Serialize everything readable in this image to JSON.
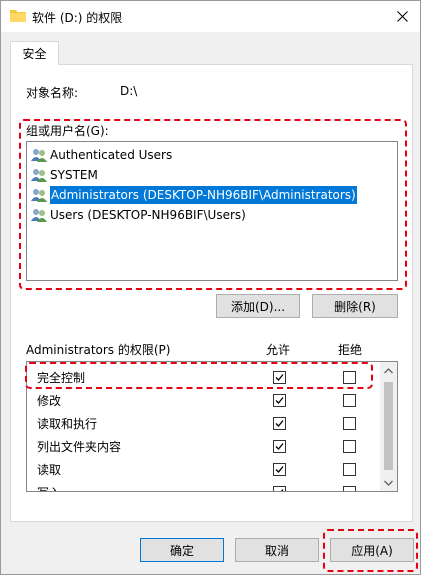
{
  "window": {
    "title": "软件 (D:) 的权限"
  },
  "tabs": [
    {
      "label": "安全"
    }
  ],
  "object": {
    "label": "对象名称:",
    "value": "D:\\"
  },
  "groups": {
    "label": "组或用户名(G):",
    "items": [
      {
        "name": "Authenticated Users",
        "selected": false
      },
      {
        "name": "SYSTEM",
        "selected": false
      },
      {
        "name": "Administrators (DESKTOP-NH96BIF\\Administrators)",
        "selected": true
      },
      {
        "name": "Users (DESKTOP-NH96BIF\\Users)",
        "selected": false
      }
    ],
    "add_label": "添加(D)...",
    "remove_label": "删除(R)"
  },
  "permissions": {
    "label": "Administrators 的权限(P)",
    "allow_header": "允许",
    "deny_header": "拒绝",
    "rows": [
      {
        "name": "完全控制",
        "allow": true,
        "deny": false
      },
      {
        "name": "修改",
        "allow": true,
        "deny": false
      },
      {
        "name": "读取和执行",
        "allow": true,
        "deny": false
      },
      {
        "name": "列出文件夹内容",
        "allow": true,
        "deny": false
      },
      {
        "name": "读取",
        "allow": true,
        "deny": false
      },
      {
        "name": "写入",
        "allow": true,
        "deny": false
      }
    ]
  },
  "footer": {
    "ok_label": "确定",
    "cancel_label": "取消",
    "apply_label": "应用(A)"
  },
  "colors": {
    "highlight": "#e60012",
    "selection": "#0078d7"
  }
}
